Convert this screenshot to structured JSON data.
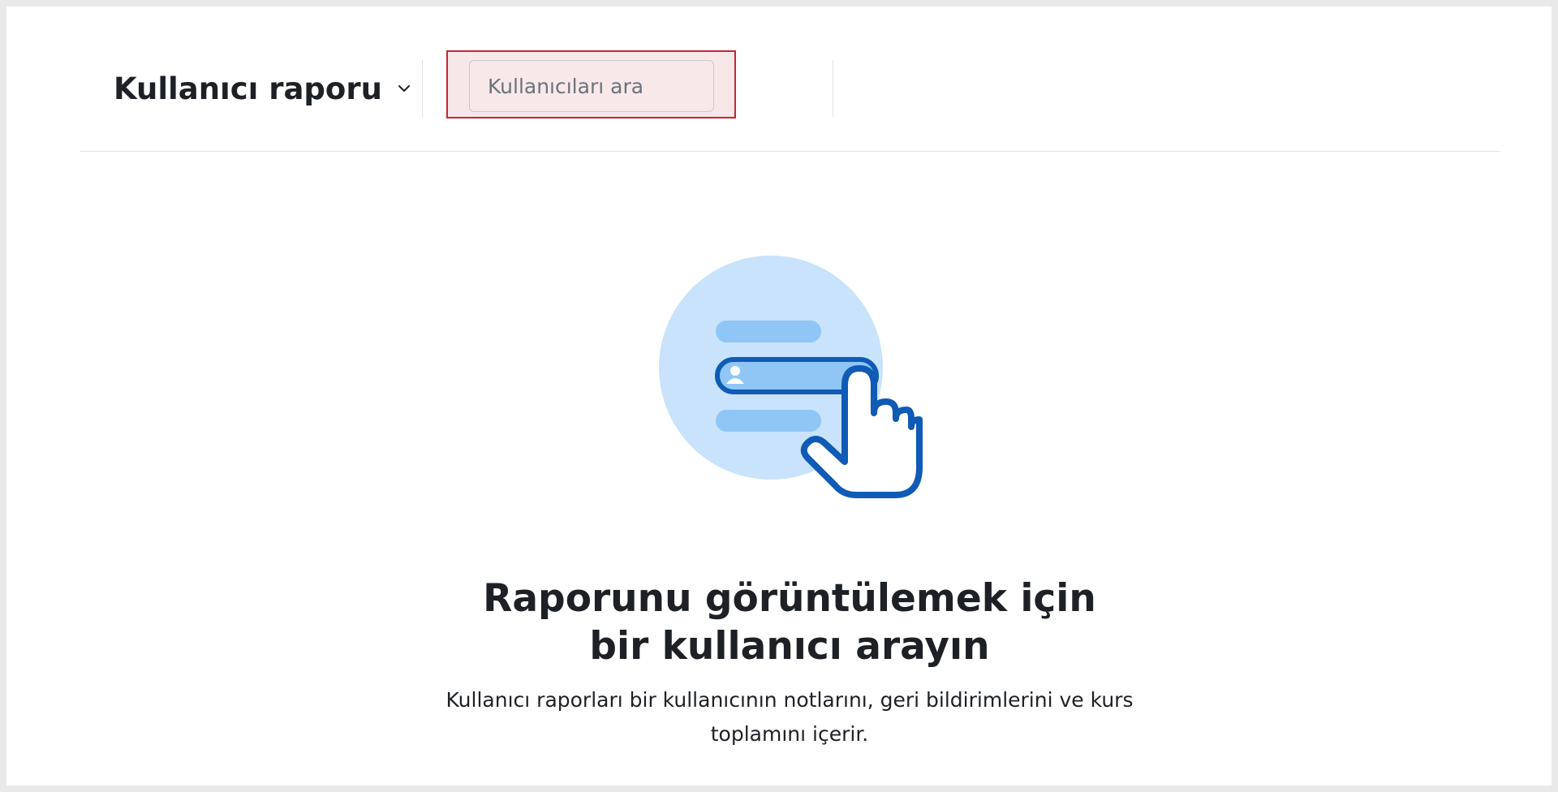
{
  "header": {
    "report_title": "Kullanıcı raporu"
  },
  "search": {
    "placeholder": "Kullanıcıları ara",
    "value": ""
  },
  "empty_state": {
    "title": "Raporunu görüntülemek için bir kullanıcı arayın",
    "description": "Kullanıcı raporları bir kullanıcının notlarını, geri bildirimlerini ve kurs toplamını içerir."
  },
  "icons": {
    "report_dropdown": "chevron-down-icon",
    "illustration": "user-search-illustration-icon"
  },
  "colors": {
    "highlight_border": "#c52633",
    "highlight_fill": "#f8e7e9",
    "illustration_circle": "#c8e3fb",
    "illustration_bar": "#8fc6f6",
    "illustration_stroke": "#0f5bb5"
  }
}
